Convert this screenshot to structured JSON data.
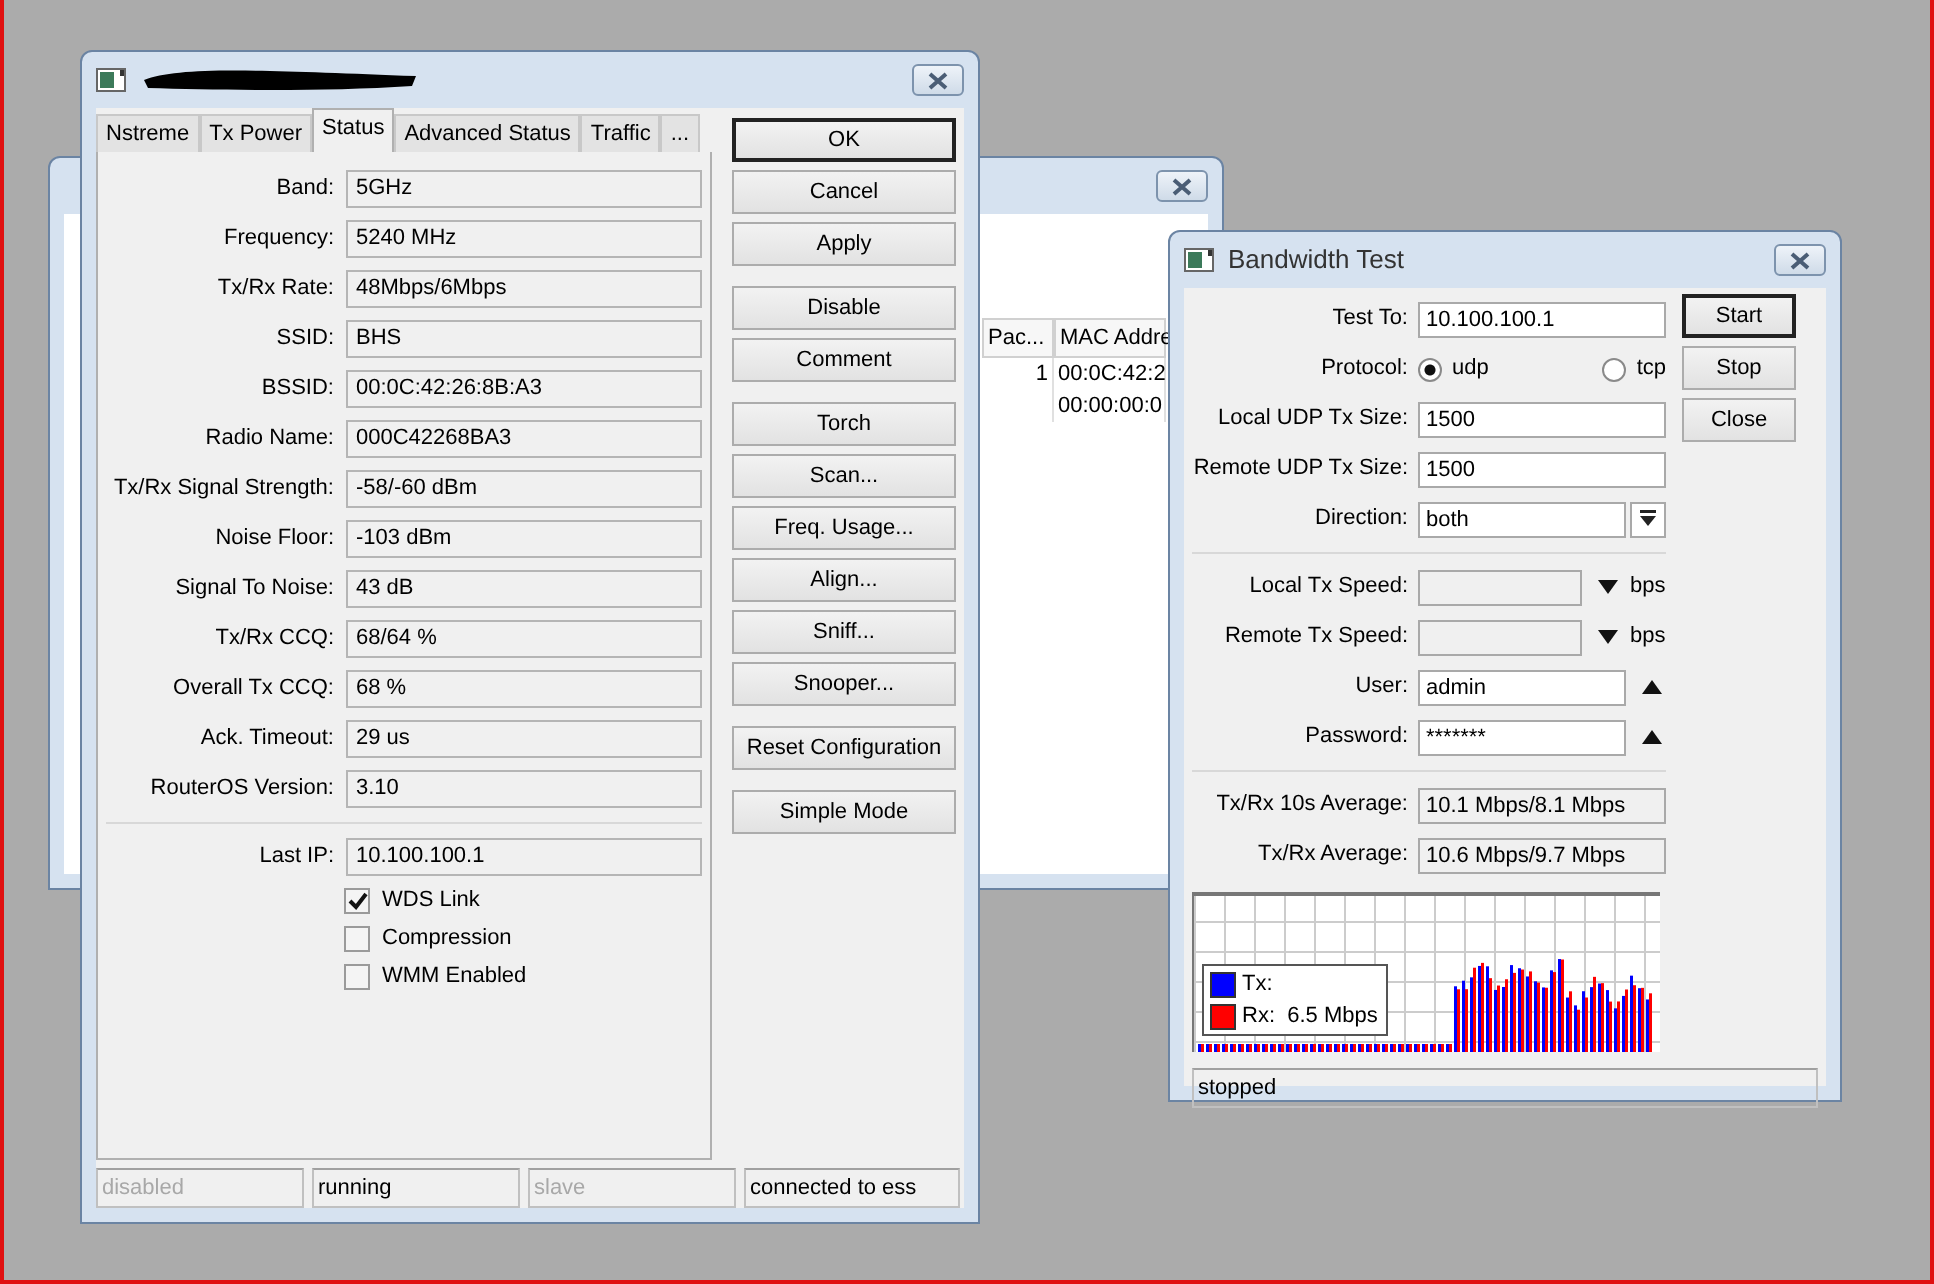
{
  "back_window": {
    "table": {
      "columns": [
        "Pac...",
        "MAC Addre"
      ],
      "rows": [
        [
          "1",
          "00:0C:42:2"
        ],
        [
          "",
          "00:00:00:0"
        ]
      ]
    }
  },
  "main_window": {
    "tabs": [
      {
        "label": "Nstreme",
        "selected": false
      },
      {
        "label": "Tx Power",
        "selected": false
      },
      {
        "label": "Status",
        "selected": true
      },
      {
        "label": "Advanced Status",
        "selected": false
      },
      {
        "label": "Traffic",
        "selected": false
      },
      {
        "label": "...",
        "selected": false
      }
    ],
    "fields": [
      {
        "label": "Band:",
        "value": "5GHz"
      },
      {
        "label": "Frequency:",
        "value": "5240 MHz"
      },
      {
        "label": "Tx/Rx Rate:",
        "value": "48Mbps/6Mbps"
      },
      {
        "label": "SSID:",
        "value": "BHS"
      },
      {
        "label": "BSSID:",
        "value": "00:0C:42:26:8B:A3"
      },
      {
        "label": "Radio Name:",
        "value": "000C42268BA3"
      },
      {
        "label": "Tx/Rx Signal Strength:",
        "value": "-58/-60 dBm"
      },
      {
        "label": "Noise Floor:",
        "value": "-103 dBm"
      },
      {
        "label": "Signal To Noise:",
        "value": "43 dB"
      },
      {
        "label": "Tx/Rx CCQ:",
        "value": "68/64 %"
      },
      {
        "label": "Overall Tx CCQ:",
        "value": "68 %"
      },
      {
        "label": "Ack. Timeout:",
        "value": "29 us"
      },
      {
        "label": "RouterOS Version:",
        "value": "3.10"
      }
    ],
    "last_ip": {
      "label": "Last IP:",
      "value": "10.100.100.1"
    },
    "checkboxes": [
      {
        "label": "WDS Link",
        "checked": true
      },
      {
        "label": "Compression",
        "checked": false
      },
      {
        "label": "WMM Enabled",
        "checked": false
      }
    ],
    "button_groups": [
      [
        {
          "label": "OK",
          "default": true
        },
        {
          "label": "Cancel",
          "default": false
        },
        {
          "label": "Apply",
          "default": false
        }
      ],
      [
        {
          "label": "Disable",
          "default": false
        },
        {
          "label": "Comment",
          "default": false
        }
      ],
      [
        {
          "label": "Torch",
          "default": false
        },
        {
          "label": "Scan...",
          "default": false
        },
        {
          "label": "Freq. Usage...",
          "default": false
        },
        {
          "label": "Align...",
          "default": false
        },
        {
          "label": "Sniff...",
          "default": false
        },
        {
          "label": "Snooper...",
          "default": false
        }
      ],
      [
        {
          "label": "Reset Configuration",
          "default": false
        }
      ],
      [
        {
          "label": "Simple Mode",
          "default": false
        }
      ]
    ],
    "status_bar": [
      {
        "text": "disabled",
        "active": false
      },
      {
        "text": "running",
        "active": true
      },
      {
        "text": "slave",
        "active": false
      },
      {
        "text": "connected to ess",
        "active": true
      }
    ]
  },
  "bandwidth_window": {
    "title": "Bandwidth Test",
    "fields": [
      {
        "kind": "input",
        "label": "Test To:",
        "value": "10.100.100.1"
      },
      {
        "kind": "radio",
        "label": "Protocol:",
        "options": [
          {
            "label": "udp",
            "selected": true
          },
          {
            "label": "tcp",
            "selected": false
          }
        ]
      },
      {
        "kind": "input",
        "label": "Local UDP Tx Size:",
        "value": "1500"
      },
      {
        "kind": "input",
        "label": "Remote UDP Tx Size:",
        "value": "1500"
      },
      {
        "kind": "select",
        "label": "Direction:",
        "value": "both"
      },
      {
        "kind": "divider"
      },
      {
        "kind": "speed",
        "label": "Local Tx Speed:",
        "unit": "bps"
      },
      {
        "kind": "speed",
        "label": "Remote Tx Speed:",
        "unit": "bps"
      },
      {
        "kind": "toggle",
        "label": "User:",
        "value": "admin"
      },
      {
        "kind": "toggle",
        "label": "Password:",
        "value": "*******"
      },
      {
        "kind": "divider"
      },
      {
        "kind": "readout",
        "label": "Tx/Rx 10s Average:",
        "value": "10.1 Mbps/8.1 Mbps"
      },
      {
        "kind": "readout",
        "label": "Tx/Rx Average:",
        "value": "10.6 Mbps/9.7 Mbps"
      }
    ],
    "legend": [
      {
        "text": "Tx:",
        "color": "#0000ff"
      },
      {
        "text": "Rx:  6.5 Mbps",
        "color": "#ff0000"
      }
    ],
    "buttons": [
      {
        "label": "Start",
        "default": true
      },
      {
        "label": "Stop",
        "default": false
      },
      {
        "label": "Close",
        "default": false
      }
    ],
    "status": "stopped"
  }
}
